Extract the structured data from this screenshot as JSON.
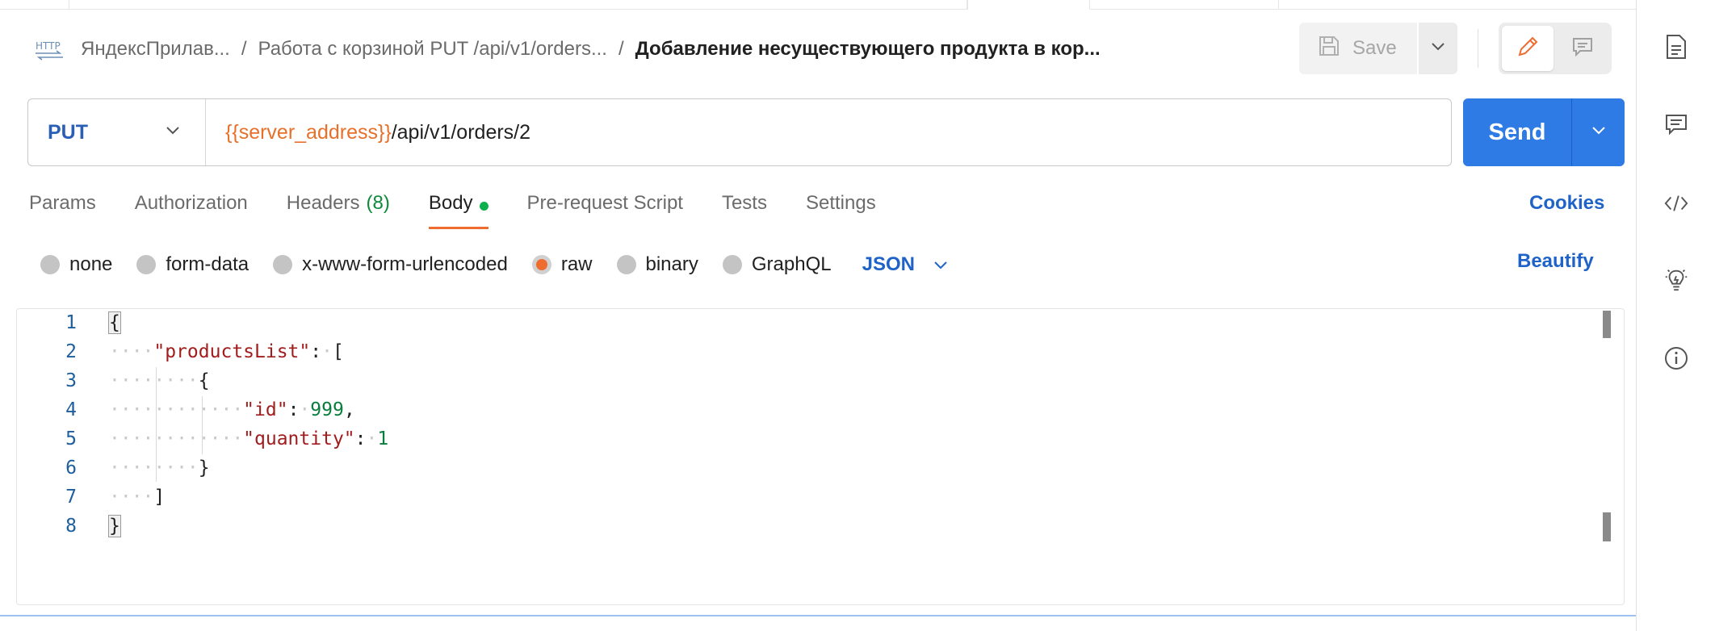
{
  "header": {
    "request_icon": "http-icon",
    "breadcrumb": [
      "ЯндексПрилав...",
      "Работа с корзиной PUT /api/v1/orders..."
    ],
    "separator": "/",
    "current": "Добавление несуществующего продукта в кор...",
    "save_label": "Save"
  },
  "url_bar": {
    "method": "PUT",
    "url_variable": "{{server_address}}",
    "url_path": "/api/v1/orders/2",
    "send_label": "Send"
  },
  "request_tabs": [
    {
      "label": "Params"
    },
    {
      "label": "Authorization"
    },
    {
      "label": "Headers",
      "count": "(8)"
    },
    {
      "label": "Body",
      "active": true,
      "indicator": "green-dot"
    },
    {
      "label": "Pre-request Script"
    },
    {
      "label": "Tests"
    },
    {
      "label": "Settings"
    }
  ],
  "cookies_label": "Cookies",
  "body_types": [
    {
      "label": "none",
      "checked": false
    },
    {
      "label": "form-data",
      "checked": false
    },
    {
      "label": "x-www-form-urlencoded",
      "checked": false
    },
    {
      "label": "raw",
      "checked": true
    },
    {
      "label": "binary",
      "checked": false
    },
    {
      "label": "GraphQL",
      "checked": false
    }
  ],
  "raw_language": "JSON",
  "beautify_label": "Beautify",
  "editor": {
    "line_numbers": [
      "1",
      "2",
      "3",
      "4",
      "5",
      "6",
      "7",
      "8"
    ],
    "tokens": {
      "open_brace": "{",
      "products_key": "\"productsList\"",
      "open_bracket": "[",
      "inner_open": "{",
      "id_key": "\"id\"",
      "id_value": "999",
      "quantity_key": "\"quantity\"",
      "quantity_value": "1",
      "inner_close": "}",
      "close_bracket": "]",
      "close_brace": "}"
    }
  },
  "right_sidebar": [
    "documentation-icon",
    "comments-icon",
    "code-icon",
    "lightbulb-icon",
    "info-icon"
  ],
  "colors": {
    "accent_orange": "#ef6c30",
    "send_blue": "#2e7be6",
    "link_blue": "#1f63c9",
    "json_key": "#a11d1d",
    "json_number": "#0a7d3c",
    "indicator_green": "#0bb04d"
  }
}
